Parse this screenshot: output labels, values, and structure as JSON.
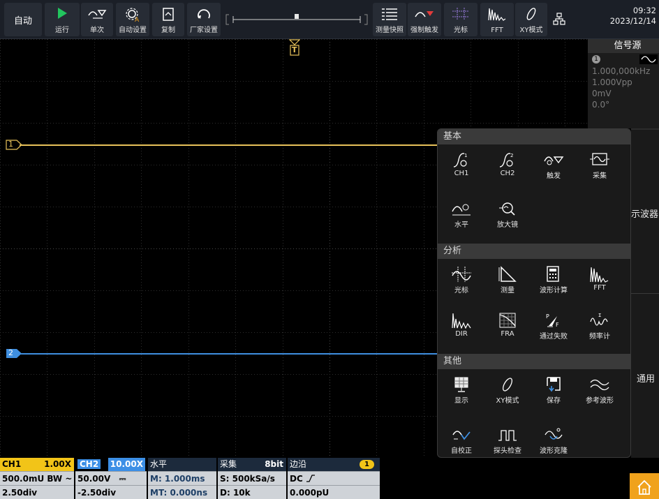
{
  "toolbar": {
    "auto_label": "自动",
    "buttons": [
      {
        "label": "运行",
        "icon": "play-icon"
      },
      {
        "label": "单次",
        "icon": "single-trigger-icon"
      },
      {
        "label": "自动设置",
        "icon": "auto-setup-icon"
      },
      {
        "label": "复制",
        "icon": "copy-icon"
      },
      {
        "label": "厂家设置",
        "icon": "factory-reset-icon"
      },
      {
        "label": "测量快照",
        "icon": "measure-snapshot-icon"
      },
      {
        "label": "强制触发",
        "icon": "force-trigger-icon"
      },
      {
        "label": "光标",
        "icon": "cursor-icon"
      },
      {
        "label": "FFT",
        "icon": "fft-icon"
      },
      {
        "label": "XY模式",
        "icon": "xy-icon"
      }
    ],
    "time": "09:32",
    "date": "2023/12/14"
  },
  "signal_source": {
    "title": "信号源",
    "channel": "1",
    "frequency": "1.000,000kHz",
    "amplitude": "1.000Vpp",
    "offset": "0mV",
    "phase": "0.0°"
  },
  "menu": {
    "sections": [
      {
        "title": "基本",
        "items": [
          {
            "label": "CH1",
            "icon": "ch1-icon"
          },
          {
            "label": "CH2",
            "icon": "ch2-icon"
          },
          {
            "label": "触发",
            "icon": "trigger-icon"
          },
          {
            "label": "采集",
            "icon": "acquire-icon"
          },
          {
            "label": "水平",
            "icon": "horizontal-icon"
          },
          {
            "label": "放大镜",
            "icon": "zoom-icon"
          }
        ]
      },
      {
        "title": "分析",
        "items": [
          {
            "label": "光标",
            "icon": "cursor-icon"
          },
          {
            "label": "测量",
            "icon": "measure-icon"
          },
          {
            "label": "波形计算",
            "icon": "math-icon"
          },
          {
            "label": "FFT",
            "icon": "fft-icon"
          },
          {
            "label": "DIR",
            "icon": "dir-icon"
          },
          {
            "label": "FRA",
            "icon": "fra-icon"
          },
          {
            "label": "通过失败",
            "icon": "pass-fail-icon"
          },
          {
            "label": "频率计",
            "icon": "frequency-counter-icon"
          }
        ]
      },
      {
        "title": "其他",
        "items": [
          {
            "label": "显示",
            "icon": "display-icon"
          },
          {
            "label": "XY模式",
            "icon": "xy-icon"
          },
          {
            "label": "保存",
            "icon": "save-icon"
          },
          {
            "label": "参考波形",
            "icon": "reference-icon"
          },
          {
            "label": "自校正",
            "icon": "self-cal-icon"
          },
          {
            "label": "探头检查",
            "icon": "probe-check-icon"
          },
          {
            "label": "波形克隆",
            "icon": "wave-clone-icon"
          }
        ]
      }
    ],
    "side_tabs": [
      "示波器",
      "通用"
    ]
  },
  "traces": {
    "ch1_marker": "1",
    "ch2_marker": "2",
    "trigger_marker": "T",
    "ch1_color": "#e8c25a",
    "ch2_color": "#3f8fe0"
  },
  "status": {
    "ch1": {
      "name": "CH1",
      "probe": "1.00X",
      "scale": "500.0mU",
      "bw": "BW",
      "coupling": "~",
      "position": "2.50div",
      "color": "#f2c418"
    },
    "ch2": {
      "name": "CH2",
      "probe": "10.00X",
      "scale": "50.00V",
      "coupling": "⎓",
      "position": "-2.50div",
      "color": "#3c8fe6"
    },
    "horizontal": {
      "name": "水平",
      "main": "M: 1.000ms",
      "trig_time": "MT: 0.000ns"
    },
    "acquire": {
      "name": "采集",
      "bits": "8bit",
      "rate": "S: 500kSa/s",
      "depth": "D: 10k"
    },
    "trigger": {
      "name": "边沿",
      "source": "1",
      "coupling": "DC",
      "level": "0.000pU"
    }
  }
}
